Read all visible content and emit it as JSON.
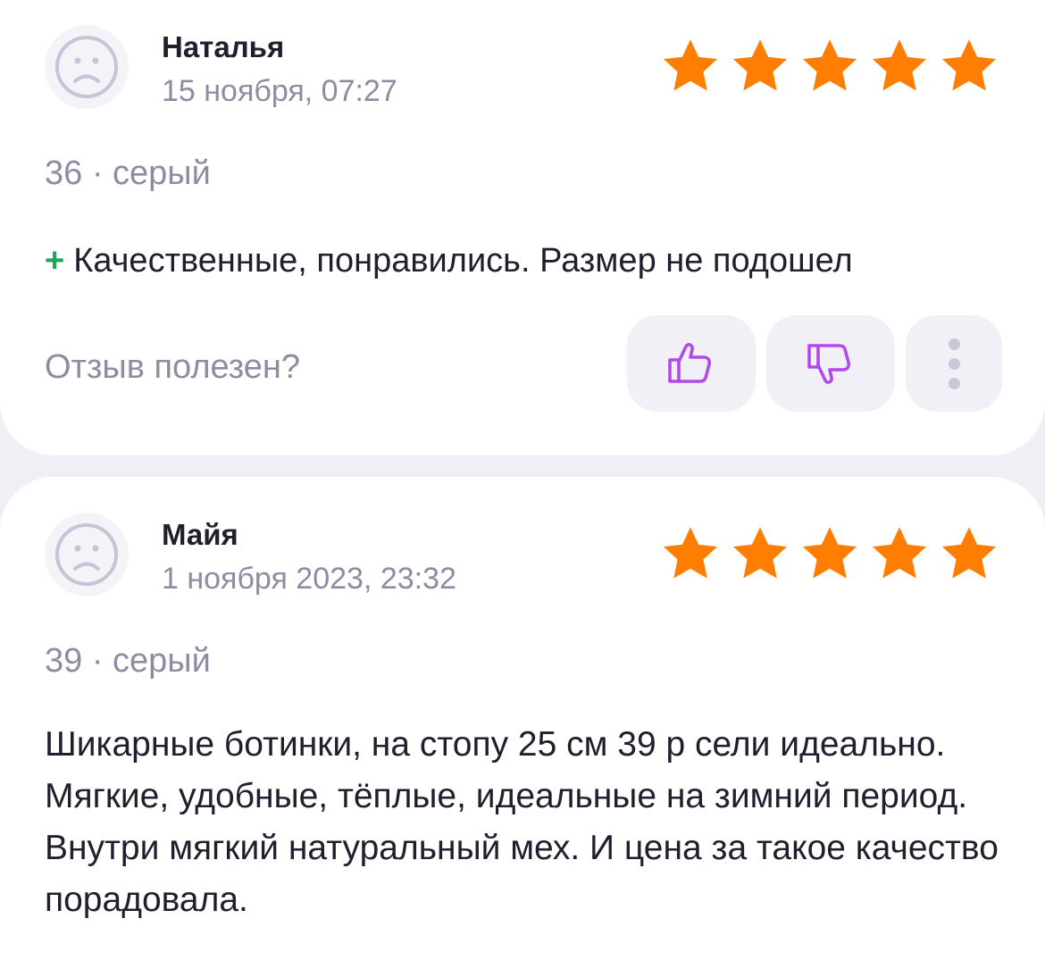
{
  "reviews": [
    {
      "author": "Наталья",
      "date": "15 ноября, 07:27",
      "rating": 5,
      "variant": "36 · серый",
      "pros_marker": "+",
      "pros_text": "Качественные, понравились. Размер не подошел",
      "helpful_question": "Отзыв полезен?"
    },
    {
      "author": "Майя",
      "date": "1 ноября 2023, 23:32",
      "rating": 5,
      "variant": "39 · серый",
      "text": "Шикарные ботинки, на стопу 25 см 39 р сели идеально. Мягкие, удобные, тёплые, идеальные на зимний период. Внутри мягкий натуральный мех. И цена за такое качество порадовала."
    }
  ],
  "colors": {
    "star": "#ff7d00",
    "accent": "#b24ae8",
    "plus": "#22a559",
    "muted_text": "#8e8ca3",
    "page_background": "#f0eff6"
  },
  "icons": {
    "avatar": "sad-face-avatar-icon",
    "like": "thumbs-up-icon",
    "dislike": "thumbs-down-icon",
    "more": "more-vertical-icon",
    "rating": "star-icon"
  }
}
